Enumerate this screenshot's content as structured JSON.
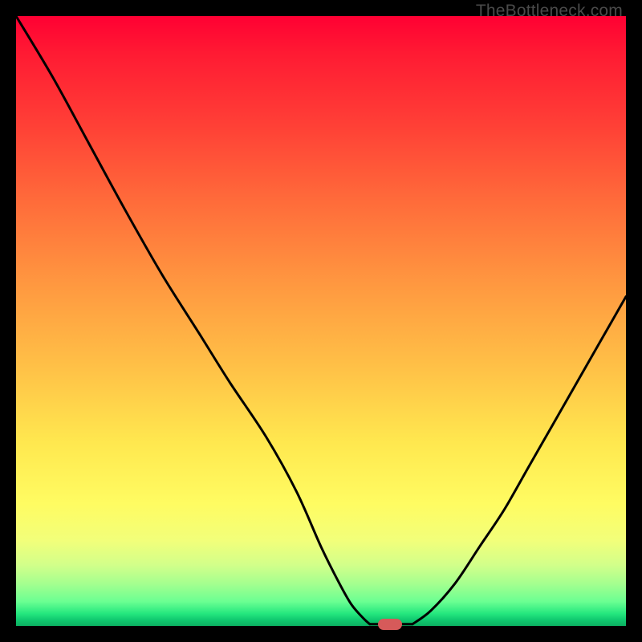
{
  "watermark": "TheBottleneck.com",
  "chart_data": {
    "type": "line",
    "title": "",
    "xlabel": "",
    "ylabel": "",
    "xlim": [
      0,
      100
    ],
    "ylim": [
      0,
      100
    ],
    "grid": false,
    "legend": false,
    "bg_gradient": {
      "top": "#ff0033",
      "mid": "#ffe84f",
      "bottom": "#0cb061"
    },
    "series": [
      {
        "name": "left-curve",
        "x": [
          0,
          6,
          12,
          18,
          24,
          30,
          35,
          41,
          46,
          50,
          53,
          55,
          57,
          58
        ],
        "y": [
          100,
          90,
          79,
          68,
          57.5,
          48,
          40,
          31,
          22,
          13,
          7,
          3.5,
          1.2,
          0.3
        ]
      },
      {
        "name": "right-curve",
        "x": [
          65,
          68,
          72,
          76,
          80,
          84,
          88,
          92,
          96,
          100
        ],
        "y": [
          0.3,
          2.5,
          7,
          13,
          19,
          26,
          33,
          40,
          47,
          54
        ]
      },
      {
        "name": "floor",
        "x": [
          58,
          65
        ],
        "y": [
          0.3,
          0.3
        ]
      }
    ],
    "marker": {
      "x": 61.3,
      "y": 0.3,
      "color": "#d65a5a"
    }
  }
}
